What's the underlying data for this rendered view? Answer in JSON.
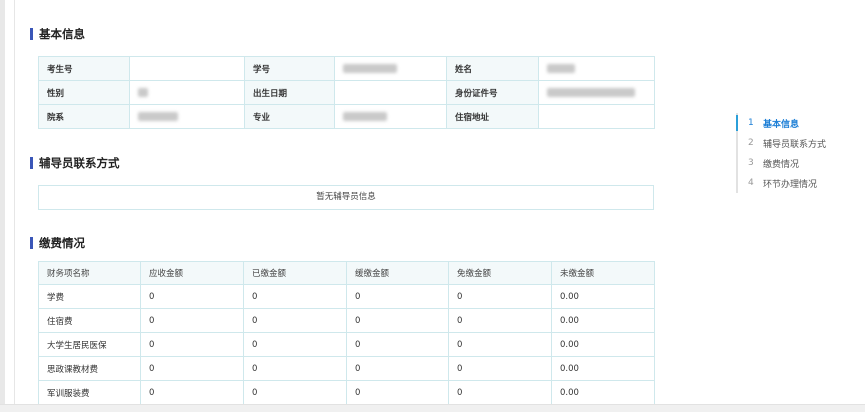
{
  "sections": {
    "basic_info": "基本信息",
    "counselor": "辅导员联系方式",
    "fees": "缴费情况"
  },
  "basic_info": {
    "rows": [
      [
        {
          "label": "考生号",
          "value": ""
        },
        {
          "label": "学号",
          "value": ""
        },
        {
          "label": "姓名",
          "value": ""
        }
      ],
      [
        {
          "label": "性别",
          "value": ""
        },
        {
          "label": "出生日期",
          "value": ""
        },
        {
          "label": "身份证件号",
          "value": ""
        }
      ],
      [
        {
          "label": "院系",
          "value": ""
        },
        {
          "label": "专业",
          "value": ""
        },
        {
          "label": "住宿地址",
          "value": ""
        }
      ]
    ]
  },
  "counselor": {
    "empty_text": "暂无辅导员信息"
  },
  "fees": {
    "headers": [
      "财务项名称",
      "应收金额",
      "已缴金额",
      "缓缴金额",
      "免缴金额",
      "未缴金额"
    ],
    "rows": [
      [
        "学费",
        "0",
        "0",
        "0",
        "0",
        "0.00"
      ],
      [
        "住宿费",
        "0",
        "0",
        "0",
        "0",
        "0.00"
      ],
      [
        "大学生居民医保",
        "0",
        "0",
        "0",
        "0",
        "0.00"
      ],
      [
        "思政课教材费",
        "0",
        "0",
        "0",
        "0",
        "0.00"
      ],
      [
        "军训服装费",
        "0",
        "0",
        "0",
        "0",
        "0.00"
      ]
    ]
  },
  "toc": {
    "items": [
      {
        "num": "1",
        "label": "基本信息"
      },
      {
        "num": "2",
        "label": "辅导员联系方式"
      },
      {
        "num": "3",
        "label": "缴费情况"
      },
      {
        "num": "4",
        "label": "环节办理情况"
      }
    ]
  },
  "colors": {
    "accent": "#3a56b8",
    "toc_active": "#1d7fd6",
    "table_border": "#cfe8ec",
    "label_bg": "#f3f9fa"
  }
}
